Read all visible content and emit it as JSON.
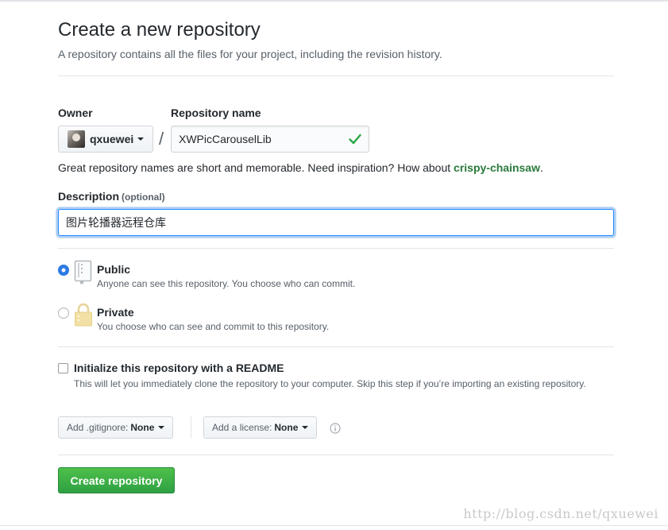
{
  "header": {
    "title": "Create a new repository",
    "subtitle": "A repository contains all the files for your project, including the revision history."
  },
  "owner": {
    "label": "Owner",
    "name": "qxuewei"
  },
  "repo": {
    "label": "Repository name",
    "separator": "/",
    "value": "XWPicCarouselLib",
    "valid": true
  },
  "hint": {
    "text": "Great repository names are short and memorable. Need inspiration? How about ",
    "suggestion": "crispy-chainsaw",
    "end": "."
  },
  "description": {
    "label": "Description",
    "optional": "(optional)",
    "value": "图片轮播器远程仓库"
  },
  "visibility": {
    "selected": "public",
    "options": [
      {
        "title": "Public",
        "desc": "Anyone can see this repository. You choose who can commit.",
        "icon": "repo-book-icon"
      },
      {
        "title": "Private",
        "desc": "You choose who can see and commit to this repository.",
        "icon": "lock-icon"
      }
    ]
  },
  "readme": {
    "checked": false,
    "title": "Initialize this repository with a README",
    "desc": "This will let you immediately clone the repository to your computer. Skip this step if you’re importing an existing repository."
  },
  "gitignore": {
    "label": "Add .gitignore:",
    "value": "None"
  },
  "license": {
    "label": "Add a license:",
    "value": "None"
  },
  "submit": {
    "label": "Create repository"
  },
  "watermark": "http://blog.csdn.net/qxuewei",
  "colors": {
    "primary_green": "#2ea043",
    "link_green": "#2a7a3c",
    "focus_blue": "#2188ff",
    "radio_blue": "#2c7be5"
  }
}
